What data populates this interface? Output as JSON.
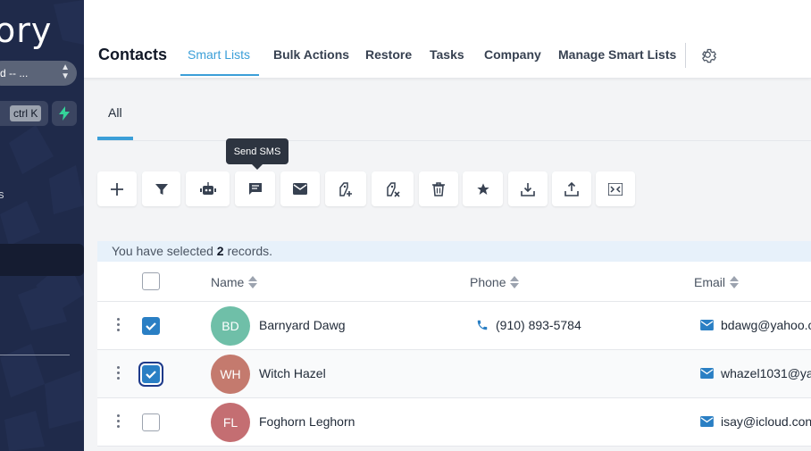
{
  "sidebar": {
    "brand_text": "ory",
    "location_select": "d -- ...",
    "search_shortcut": "ctrl K",
    "partial_item": "s"
  },
  "header": {
    "title": "Contacts",
    "nav": [
      "Smart Lists",
      "Bulk Actions",
      "Restore",
      "Tasks",
      "Company",
      "Manage Smart Lists"
    ],
    "active_nav": "Smart Lists"
  },
  "tabs": {
    "all": "All"
  },
  "tooltip": "Send SMS",
  "toolbar": [
    {
      "icon": "add-icon",
      "name": "add-contact-button"
    },
    {
      "icon": "filter-icon",
      "name": "filter-button"
    },
    {
      "icon": "robot-icon",
      "name": "add-to-automation-button"
    },
    {
      "icon": "message-icon",
      "name": "send-sms-button"
    },
    {
      "icon": "mail-icon",
      "name": "send-email-button"
    },
    {
      "icon": "tag-add-icon",
      "name": "add-tag-button"
    },
    {
      "icon": "tag-remove-icon",
      "name": "remove-tag-button"
    },
    {
      "icon": "trash-icon",
      "name": "delete-button"
    },
    {
      "icon": "star-icon",
      "name": "review-request-button"
    },
    {
      "icon": "download-icon",
      "name": "export-button"
    },
    {
      "icon": "upload-icon",
      "name": "import-button"
    },
    {
      "icon": "merge-icon",
      "name": "merge-button"
    }
  ],
  "selection": {
    "prefix": "You have selected ",
    "count": "2",
    "suffix": " records."
  },
  "table": {
    "headers": {
      "name": "Name",
      "phone": "Phone",
      "email": "Email"
    },
    "rows": [
      {
        "initials": "BD",
        "name": "Barnyard Dawg",
        "phone": "(910) 893-5784",
        "email": "bdawg@yahoo.c",
        "checked": true,
        "avatar_color": "#6fbfa8"
      },
      {
        "initials": "WH",
        "name": "Witch Hazel",
        "phone": "",
        "email": "whazel1031@ya",
        "checked": true,
        "avatar_color": "#c47a6e"
      },
      {
        "initials": "FL",
        "name": "Foghorn Leghorn",
        "phone": "",
        "email": "isay@icloud.con",
        "checked": false,
        "avatar_color": "#c46e72"
      }
    ]
  },
  "colors": {
    "accent": "#3b9fd8",
    "sidebar": "#1f2a4a",
    "check": "#2a7fc4"
  }
}
